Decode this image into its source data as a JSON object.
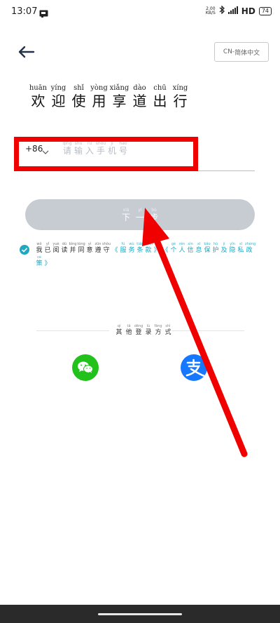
{
  "status_bar": {
    "time": "13:07",
    "speed_value": "2.00",
    "speed_unit": "KB/S",
    "network": "HD",
    "battery": "74"
  },
  "header": {
    "lang_code": "CN-",
    "lang_chars": [
      "简",
      "体",
      "中",
      "文"
    ]
  },
  "welcome": [
    {
      "p": "huān",
      "c": "欢"
    },
    {
      "p": "yíng",
      "c": "迎"
    },
    {
      "p": "shǐ",
      "c": "使"
    },
    {
      "p": "yòng",
      "c": "用"
    },
    {
      "p": "xiǎng",
      "c": "享"
    },
    {
      "p": "dào",
      "c": "道"
    },
    {
      "p": "chū",
      "c": "出"
    },
    {
      "p": "xíng",
      "c": "行"
    }
  ],
  "phone": {
    "country_code": "+86",
    "placeholder": [
      {
        "p": "qǐng",
        "c": "请"
      },
      {
        "p": "shū",
        "c": "输"
      },
      {
        "p": "rù",
        "c": "入"
      },
      {
        "p": "shǒu",
        "c": "手"
      },
      {
        "p": "jī",
        "c": "机"
      },
      {
        "p": "hào",
        "c": "号"
      }
    ]
  },
  "next_button": [
    {
      "p": "xià",
      "c": "下"
    },
    {
      "p": "yí",
      "c": "一"
    },
    {
      "p": "bù",
      "c": "步"
    }
  ],
  "agreement": {
    "text": [
      {
        "p": "wǒ",
        "c": "我"
      },
      {
        "p": "yǐ",
        "c": "已"
      },
      {
        "p": "yuè",
        "c": "阅"
      },
      {
        "p": "dú",
        "c": "读"
      },
      {
        "p": "bìng",
        "c": "并"
      },
      {
        "p": "tóng",
        "c": "同"
      },
      {
        "p": "yì",
        "c": "意"
      },
      {
        "p": "zūn",
        "c": "遵"
      },
      {
        "p": "shǒu",
        "c": "守"
      }
    ],
    "service_link": [
      {
        "p": "",
        "c": "《"
      },
      {
        "p": "fú",
        "c": "服"
      },
      {
        "p": "wù",
        "c": "务"
      },
      {
        "p": "tiáo",
        "c": "条"
      },
      {
        "p": "kuǎn",
        "c": "款"
      },
      {
        "p": "",
        "c": "》"
      }
    ],
    "privacy_link": [
      {
        "p": "",
        "c": "《"
      },
      {
        "p": "gè",
        "c": "个"
      },
      {
        "p": "rén",
        "c": "人"
      },
      {
        "p": "xìn",
        "c": "信"
      },
      {
        "p": "xī",
        "c": "息"
      },
      {
        "p": "bǎo",
        "c": "保"
      },
      {
        "p": "hù",
        "c": "护"
      },
      {
        "p": "jí",
        "c": "及"
      },
      {
        "p": "yǐn",
        "c": "隐"
      },
      {
        "p": "sī",
        "c": "私"
      },
      {
        "p": "zhèng",
        "c": "政"
      },
      {
        "p": "cè",
        "c": "策"
      },
      {
        "p": "",
        "c": "》"
      }
    ]
  },
  "other_login": [
    {
      "p": "qí",
      "c": "其"
    },
    {
      "p": "tā",
      "c": "他"
    },
    {
      "p": "dēng",
      "c": "登"
    },
    {
      "p": "lù",
      "c": "录"
    },
    {
      "p": "fāng",
      "c": "方"
    },
    {
      "p": "shì",
      "c": "式"
    }
  ],
  "icons": {
    "back": "arrow-left",
    "wechat": "wechat",
    "alipay": "alipay",
    "chevron": "chevron-down",
    "check": "check-circle"
  },
  "colors": {
    "accent_teal": "#1fa8bf",
    "button_disabled": "#c7ccd3",
    "wechat_green": "#22c11c",
    "alipay_blue": "#1677ff",
    "annotation_red": "#f10000"
  }
}
